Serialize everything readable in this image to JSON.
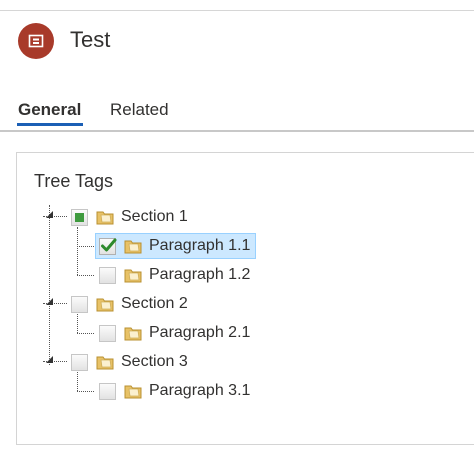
{
  "header": {
    "record_title": "Test",
    "icon": "record-icon",
    "icon_color": "#a83a2a"
  },
  "tabs": [
    {
      "label": "General",
      "active": true
    },
    {
      "label": "Related",
      "active": false
    }
  ],
  "accent_color": "#1b5fb5",
  "section": {
    "label": "Tree Tags"
  },
  "tree": [
    {
      "label": "Section 1",
      "state": "partial",
      "children": [
        {
          "label": "Paragraph 1.1",
          "state": "checked",
          "selected": true
        },
        {
          "label": "Paragraph 1.2",
          "state": "unchecked",
          "selected": false
        }
      ]
    },
    {
      "label": "Section 2",
      "state": "unchecked",
      "children": [
        {
          "label": "Paragraph 2.1",
          "state": "unchecked",
          "selected": false
        }
      ]
    },
    {
      "label": "Section 3",
      "state": "unchecked",
      "children": [
        {
          "label": "Paragraph 3.1",
          "state": "unchecked",
          "selected": false
        }
      ]
    }
  ]
}
